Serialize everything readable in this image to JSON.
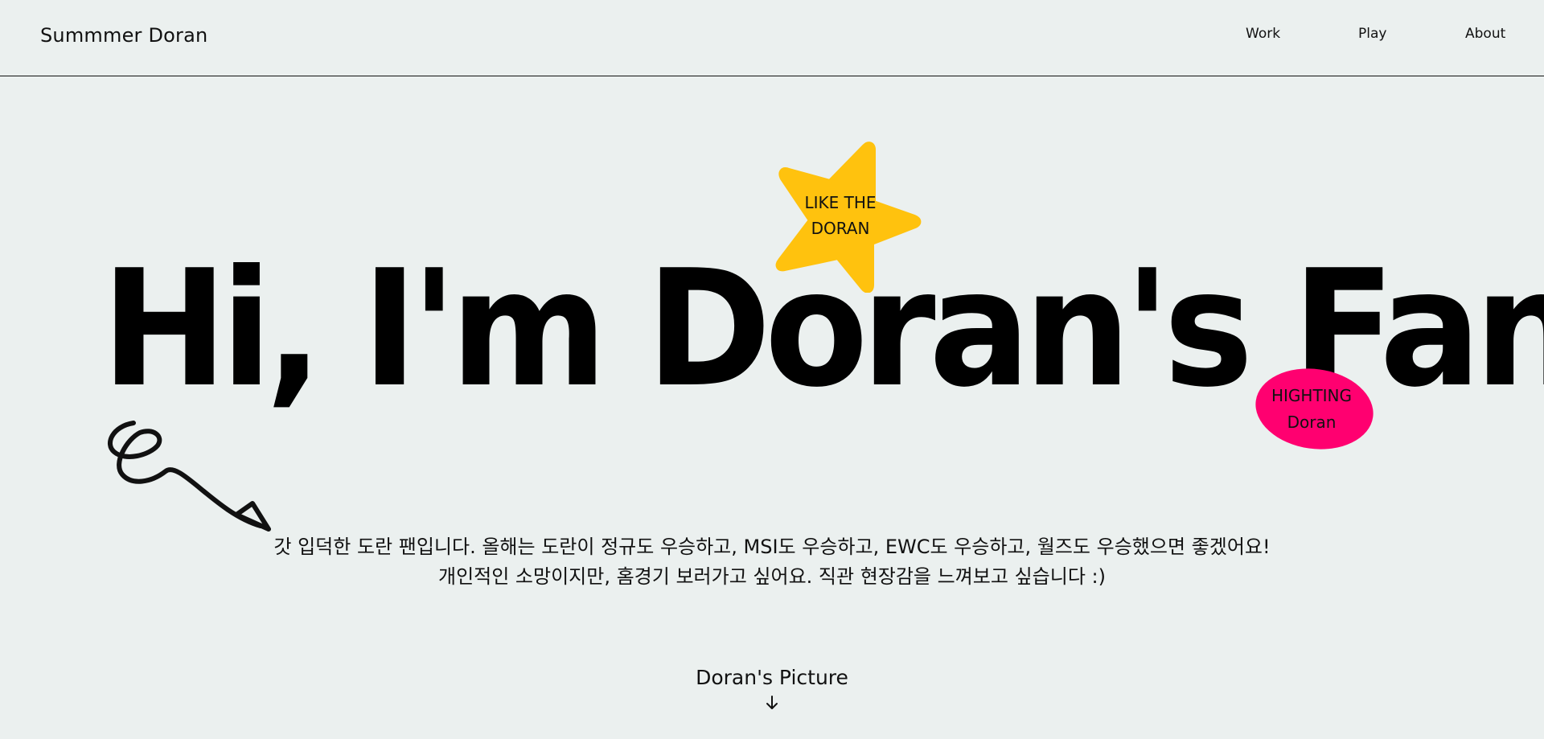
{
  "header": {
    "logo": "Summmer Doran",
    "nav": [
      {
        "label": "Work"
      },
      {
        "label": "Play"
      },
      {
        "label": "About"
      }
    ]
  },
  "hero": {
    "headline": "Hi, I'm Doran's Fan",
    "star_badge": {
      "line1": "LIKE THE",
      "line2": "DORAN",
      "color": "#ffc20e"
    },
    "oval_badge": {
      "line1": "HIGHTING",
      "line2": "Doran",
      "color": "#ff0070"
    },
    "decoration_icon": "squiggle-arrow-icon"
  },
  "intro": {
    "line1": "갓 입덕한 도란 팬입니다. 올해는 도란이 정규도 우승하고, MSI도 우승하고, EWC도 우승하고, 월즈도 우승했으면 좋겠어요!",
    "line2": "개인적인 소망이지만, 홈경기 보러가고 싶어요. 직관 현장감을 느껴보고 싶습니다 :)"
  },
  "picture_link": {
    "label": "Doran's Picture",
    "icon": "arrow-down-icon"
  },
  "colors": {
    "background": "#ebf0ef",
    "text": "#000000",
    "star": "#ffc20e",
    "oval": "#ff0070"
  }
}
